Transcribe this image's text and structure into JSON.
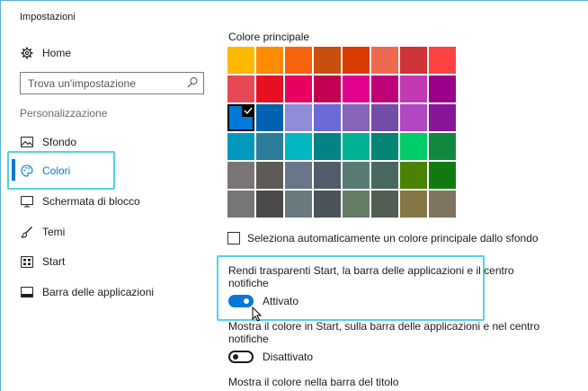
{
  "window": {
    "title": "Impostazioni"
  },
  "sidebar": {
    "home_label": "Home",
    "home_icon": "gear-icon",
    "search_placeholder": "Trova un'impostazione",
    "section_label": "Personalizzazione",
    "items": [
      {
        "label": "Sfondo",
        "icon": "image-icon",
        "selected": false
      },
      {
        "label": "Colori",
        "icon": "palette-icon",
        "selected": true
      },
      {
        "label": "Schermata di blocco",
        "icon": "monitor-icon",
        "selected": false
      },
      {
        "label": "Temi",
        "icon": "brush-icon",
        "selected": false
      },
      {
        "label": "Start",
        "icon": "start-grid-icon",
        "selected": false
      },
      {
        "label": "Barra delle applicazioni",
        "icon": "taskbar-icon",
        "selected": false
      }
    ]
  },
  "main": {
    "heading": "Colore principale",
    "swatches": [
      "#FFB900",
      "#FF8C00",
      "#F7630C",
      "#CA5010",
      "#DA3B01",
      "#EF6950",
      "#D13438",
      "#FF4343",
      "#E74856",
      "#E81123",
      "#EA005E",
      "#C30052",
      "#E3008C",
      "#BF0077",
      "#C239B3",
      "#9A0089",
      "#0078D7",
      "#0063B1",
      "#8E8CD8",
      "#6B69D6",
      "#8764B8",
      "#744DA9",
      "#B146C2",
      "#881798",
      "#0099BC",
      "#2D7D9A",
      "#00B7C3",
      "#038387",
      "#00B294",
      "#018574",
      "#00CC6A",
      "#10893E",
      "#7A7574",
      "#5D5A58",
      "#68768A",
      "#515C6B",
      "#567C73",
      "#486860",
      "#498205",
      "#107C10",
      "#767676",
      "#4C4A48",
      "#69797E",
      "#4A5459",
      "#647C64",
      "#525E54",
      "#847545",
      "#7E735F"
    ],
    "selected_swatch_index": 16,
    "auto_color_label": "Seleziona automaticamente un colore principale dallo sfondo",
    "transparency": {
      "line1": "Rendi trasparenti Start, la barra delle applicazioni e il centro",
      "line2": "notifiche",
      "state_label": "Attivato",
      "on": true
    },
    "show_color_start": {
      "line1": "Mostra il colore in Start, sulla barra delle applicazioni e nel centro",
      "line2": "notifiche",
      "state_label": "Disattivato",
      "on": false
    },
    "show_color_titlebar_label": "Mostra il colore nella barra del titolo"
  },
  "colors": {
    "accent": "#0078D7",
    "highlight": "#4FD3E6"
  }
}
